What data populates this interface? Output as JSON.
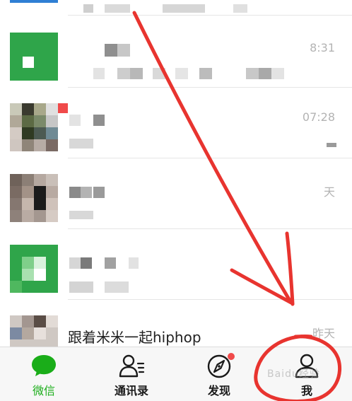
{
  "chats": [
    {
      "time": ""
    },
    {
      "time": "8:31"
    },
    {
      "time": "07:28"
    },
    {
      "time": "天"
    },
    {
      "time": ""
    },
    {
      "time": "昨天",
      "message": "跟着米米一起hiphop"
    }
  ],
  "tabbar": {
    "tabs": [
      {
        "label": "微信",
        "icon": "chat-bubble-icon",
        "active": true
      },
      {
        "label": "通讯录",
        "icon": "contacts-icon"
      },
      {
        "label": "发现",
        "icon": "compass-icon"
      },
      {
        "label": "我",
        "icon": "person-icon"
      }
    ]
  },
  "watermark": "Baidu经验",
  "colors": {
    "active_tab": "#1aad19",
    "annotation": "#e8342f",
    "badge": "#f04a4a"
  }
}
